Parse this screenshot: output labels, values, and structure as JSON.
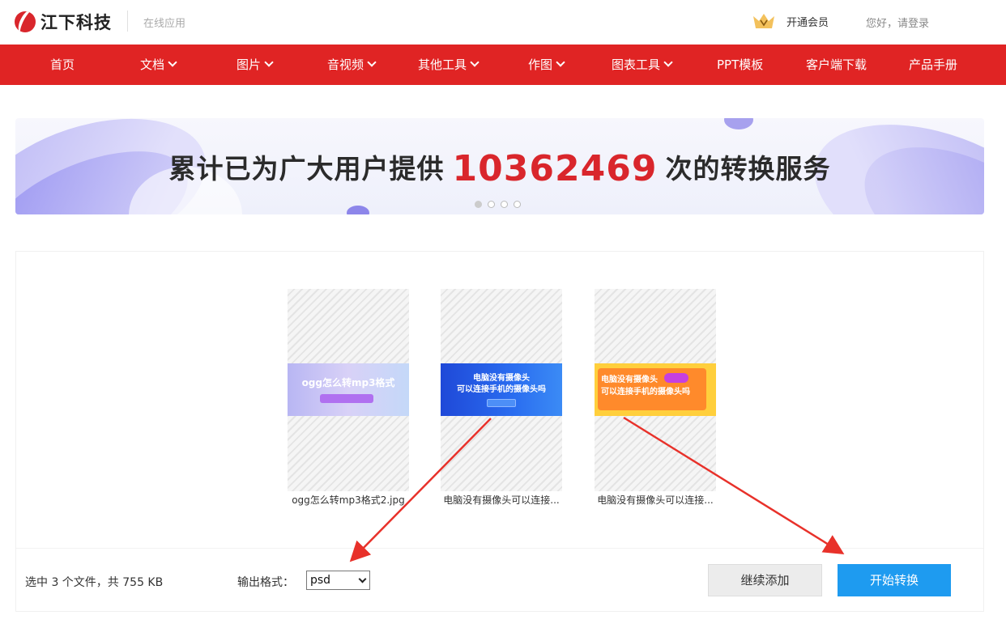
{
  "header": {
    "logo_text": "江下科技",
    "logo_sub": "在线应用",
    "vip_label": "开通会员",
    "login_text": "您好，请登录"
  },
  "nav": {
    "items": [
      {
        "label": "首页",
        "has_dropdown": false
      },
      {
        "label": "文档",
        "has_dropdown": true
      },
      {
        "label": "图片",
        "has_dropdown": true
      },
      {
        "label": "音视频",
        "has_dropdown": true
      },
      {
        "label": "其他工具",
        "has_dropdown": true
      },
      {
        "label": "作图",
        "has_dropdown": true
      },
      {
        "label": "图表工具",
        "has_dropdown": true
      },
      {
        "label": "PPT模板",
        "has_dropdown": false
      },
      {
        "label": "客户端下载",
        "has_dropdown": false
      },
      {
        "label": "产品手册",
        "has_dropdown": false
      }
    ]
  },
  "banner": {
    "text_before": "累计已为广大用户提供",
    "count": "10362469",
    "text_after": "次的转换服务",
    "slide_count": 4,
    "active_slide": 1
  },
  "files": [
    {
      "name": "ogg怎么转mp3格式2.jpg",
      "preview_title": "ogg怎么转mp3格式"
    },
    {
      "name": "电脑没有摄像头可以连接...",
      "preview_title": "电脑没有摄像头",
      "preview_subtitle": "可以连接手机的摄像头吗"
    },
    {
      "name": "电脑没有摄像头可以连接...",
      "preview_title": "电脑没有摄像头",
      "preview_subtitle": "可以连接手机的摄像头吗"
    }
  ],
  "toolbar": {
    "selected_info": "选中 3 个文件，共 755 KB",
    "format_label": "输出格式：",
    "format_value": "psd",
    "add_label": "继续添加",
    "start_label": "开始转换"
  },
  "colors": {
    "nav_bg": "#e02424",
    "brand_red": "#d9262c",
    "start_button": "#1e9bf0",
    "annotation_arrow": "#e8312a"
  }
}
